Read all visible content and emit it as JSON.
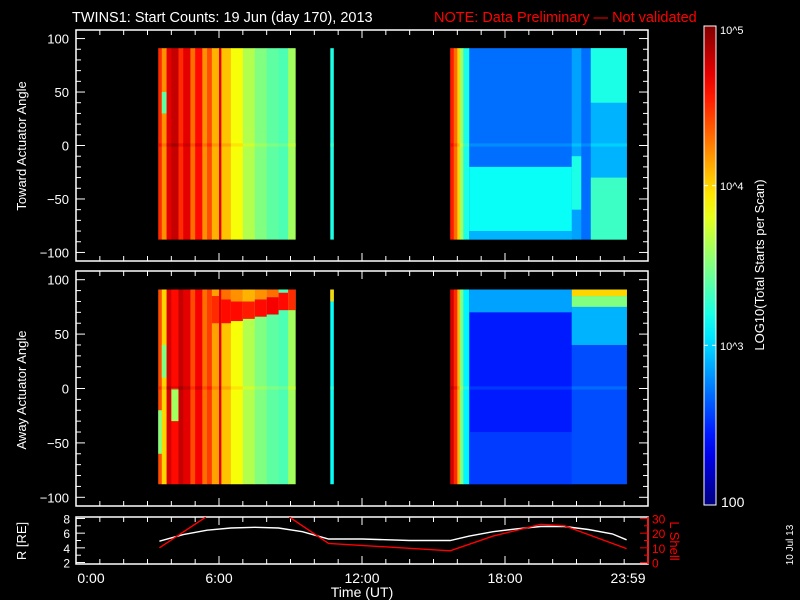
{
  "header": {
    "title": "TWINS1: Start Counts: 19 Jun (day 170), 2013",
    "note": "NOTE: Data Preliminary — Not validated"
  },
  "side_date": "10 Jul 13",
  "colors": {
    "background": "#000000",
    "axes": "#ffffff",
    "note": "#ff0000",
    "lshell": "#ff0000",
    "r": "#ffffff"
  },
  "colorbar": {
    "label": "LOG10(Total Starts per Scan)",
    "range_log10": [
      2,
      5
    ],
    "colormap": "jet",
    "ticks": [
      {
        "value": 5,
        "label": "10^5"
      },
      {
        "value": 4,
        "label": "10^4"
      },
      {
        "value": 3,
        "label": "10^3"
      },
      {
        "value": 2,
        "label": "100"
      }
    ]
  },
  "xaxis": {
    "label": "Time (UT)",
    "range_hours": [
      0,
      24
    ],
    "ticks": [
      {
        "value": 0,
        "label": "0:00"
      },
      {
        "value": 6,
        "label": "6:00"
      },
      {
        "value": 12,
        "label": "12:00"
      },
      {
        "value": 18,
        "label": "18:00"
      },
      {
        "value": 24,
        "label": "23:59"
      }
    ]
  },
  "chart_data": [
    {
      "type": "heatmap",
      "panel": "toward",
      "ylabel": "Toward Actuator Angle",
      "ylim": [
        -108,
        108
      ],
      "yticks": [
        "-100",
        "-50",
        "0",
        "50",
        "100"
      ],
      "angle_range": [
        -88,
        91
      ],
      "value_units": "log10 counts",
      "columns": [
        {
          "t": [
            3.45,
            3.6
          ],
          "v": 4.5
        },
        {
          "t": [
            3.6,
            3.8
          ],
          "v": 4.2,
          "bands": [
            {
              "a": [
                30,
                50
              ],
              "v": 3.4
            }
          ]
        },
        {
          "t": [
            3.8,
            4.0
          ],
          "v": 4.7
        },
        {
          "t": [
            4.0,
            4.3
          ],
          "v": 4.8
        },
        {
          "t": [
            4.3,
            4.5
          ],
          "v": 4.5
        },
        {
          "t": [
            4.5,
            4.8
          ],
          "v": 4.7
        },
        {
          "t": [
            4.8,
            5.0
          ],
          "v": 4.3
        },
        {
          "t": [
            5.0,
            5.3
          ],
          "v": 4.6
        },
        {
          "t": [
            5.3,
            5.5
          ],
          "v": 4.2
        },
        {
          "t": [
            5.5,
            5.7
          ],
          "v": 4.4
        },
        {
          "t": [
            5.7,
            6.0
          ],
          "v": 4.1
        },
        {
          "t": [
            6.0,
            6.1
          ],
          "v": 4.7
        },
        {
          "t": [
            6.1,
            6.5
          ],
          "v": 4.05
        },
        {
          "t": [
            6.5,
            7.0
          ],
          "v": 3.85
        },
        {
          "t": [
            7.0,
            7.5
          ],
          "v": 3.65
        },
        {
          "t": [
            7.5,
            8.0
          ],
          "v": 3.5
        },
        {
          "t": [
            8.0,
            8.5
          ],
          "v": 3.4
        },
        {
          "t": [
            8.5,
            8.9
          ],
          "v": 3.35
        },
        {
          "t": [
            8.9,
            9.2
          ],
          "v": 3.6
        },
        {
          "t": [
            10.67,
            10.8
          ],
          "v": 3.2
        },
        {
          "t": [
            15.7,
            15.85
          ],
          "v": 4.55
        },
        {
          "t": [
            15.85,
            16.0
          ],
          "v": 4.3
        },
        {
          "t": [
            16.0,
            16.1
          ],
          "v": 4.0
        },
        {
          "t": [
            16.1,
            16.25
          ],
          "v": 3.6
        },
        {
          "t": [
            16.25,
            16.5
          ],
          "v": 3.2
        },
        {
          "t": [
            16.5,
            20.8
          ],
          "v": 2.7,
          "bands": [
            {
              "a": [
                -80,
                -20
              ],
              "v": 3.15
            },
            {
              "a": [
                -88,
                -80
              ],
              "v": 2.9
            }
          ]
        },
        {
          "t": [
            20.8,
            21.2
          ],
          "v": 2.85,
          "bands": [
            {
              "a": [
                -60,
                -10
              ],
              "v": 3.2
            }
          ]
        },
        {
          "t": [
            21.2,
            21.6
          ],
          "v": 2.7
        },
        {
          "t": [
            21.6,
            23.1
          ],
          "v": 2.9,
          "bands": [
            {
              "a": [
                40,
                91
              ],
              "v": 3.2
            },
            {
              "a": [
                -88,
                -30
              ],
              "v": 3.3
            }
          ]
        }
      ]
    },
    {
      "type": "heatmap",
      "panel": "away",
      "ylabel": "Away Actuator Angle",
      "ylim": [
        -108,
        108
      ],
      "yticks": [
        "-100",
        "-50",
        "0",
        "50",
        "100"
      ],
      "angle_range": [
        -88,
        91
      ],
      "value_units": "log10 counts",
      "columns": [
        {
          "t": [
            3.45,
            3.6
          ],
          "v": 4.4,
          "bands": [
            {
              "a": [
                -60,
                -20
              ],
              "v": 3.5
            }
          ]
        },
        {
          "t": [
            3.6,
            3.8
          ],
          "v": 4.0,
          "bands": [
            {
              "a": [
                10,
                40
              ],
              "v": 3.5
            }
          ]
        },
        {
          "t": [
            3.8,
            4.0
          ],
          "v": 4.75
        },
        {
          "t": [
            4.0,
            4.3
          ],
          "v": 4.6,
          "bands": [
            {
              "a": [
                -30,
                0
              ],
              "v": 3.6
            }
          ]
        },
        {
          "t": [
            4.3,
            4.5
          ],
          "v": 4.8
        },
        {
          "t": [
            4.5,
            4.8
          ],
          "v": 4.7
        },
        {
          "t": [
            4.8,
            5.0
          ],
          "v": 4.4
        },
        {
          "t": [
            5.0,
            5.3
          ],
          "v": 4.65
        },
        {
          "t": [
            5.3,
            5.5
          ],
          "v": 4.3
        },
        {
          "t": [
            5.5,
            5.7
          ],
          "v": 4.45
        },
        {
          "t": [
            5.7,
            6.0
          ],
          "v": 4.15,
          "bands": [
            {
              "a": [
                60,
                85
              ],
              "v": 4.5
            }
          ]
        },
        {
          "t": [
            6.0,
            6.1
          ],
          "v": 4.7
        },
        {
          "t": [
            6.1,
            6.5
          ],
          "v": 4.05,
          "bands": [
            {
              "a": [
                60,
                82
              ],
              "v": 4.6
            },
            {
              "a": [
                82,
                91
              ],
              "v": 4.3
            }
          ]
        },
        {
          "t": [
            6.5,
            7.0
          ],
          "v": 3.85,
          "bands": [
            {
              "a": [
                62,
                80
              ],
              "v": 4.6
            },
            {
              "a": [
                80,
                91
              ],
              "v": 4.2
            }
          ]
        },
        {
          "t": [
            7.0,
            7.5
          ],
          "v": 3.65,
          "bands": [
            {
              "a": [
                64,
                80
              ],
              "v": 4.55
            },
            {
              "a": [
                80,
                91
              ],
              "v": 4.1
            }
          ]
        },
        {
          "t": [
            7.5,
            8.0
          ],
          "v": 3.5,
          "bands": [
            {
              "a": [
                66,
                82
              ],
              "v": 4.6
            },
            {
              "a": [
                82,
                91
              ],
              "v": 4.2
            }
          ]
        },
        {
          "t": [
            8.0,
            8.5
          ],
          "v": 3.4,
          "bands": [
            {
              "a": [
                68,
                84
              ],
              "v": 4.65
            },
            {
              "a": [
                84,
                91
              ],
              "v": 4.3
            }
          ]
        },
        {
          "t": [
            8.5,
            8.9
          ],
          "v": 3.35,
          "bands": [
            {
              "a": [
                72,
                88
              ],
              "v": 4.6
            }
          ]
        },
        {
          "t": [
            8.9,
            9.2
          ],
          "v": 3.6,
          "bands": [
            {
              "a": [
                72,
                91
              ],
              "v": 4.5
            }
          ]
        },
        {
          "t": [
            10.67,
            10.8
          ],
          "v": 3.15,
          "bands": [
            {
              "a": [
                80,
                91
              ],
              "v": 4.0
            }
          ]
        },
        {
          "t": [
            15.7,
            15.85
          ],
          "v": 4.75
        },
        {
          "t": [
            15.85,
            16.0
          ],
          "v": 4.5
        },
        {
          "t": [
            16.0,
            16.1
          ],
          "v": 4.1
        },
        {
          "t": [
            16.1,
            16.25
          ],
          "v": 3.5
        },
        {
          "t": [
            16.25,
            16.5
          ],
          "v": 3.1
        },
        {
          "t": [
            16.5,
            20.8
          ],
          "v": 2.45,
          "bands": [
            {
              "a": [
                70,
                91
              ],
              "v": 2.85
            },
            {
              "a": [
                -88,
                -40
              ],
              "v": 2.55
            }
          ]
        },
        {
          "t": [
            20.8,
            23.1
          ],
          "v": 2.6,
          "bands": [
            {
              "a": [
                40,
                75
              ],
              "v": 2.9
            },
            {
              "a": [
                75,
                85
              ],
              "v": 3.5
            },
            {
              "a": [
                85,
                91
              ],
              "v": 4.0
            }
          ]
        }
      ]
    },
    {
      "type": "line",
      "panel": "orbit",
      "ylabel": "R [RE]",
      "ylabel_right": "L Shell",
      "ylim": [
        1.8,
        8.2
      ],
      "yticks": [
        "2",
        "4",
        "6",
        "8"
      ],
      "ylim_right": [
        -1,
        31
      ],
      "yticks_right": [
        "0",
        "10",
        "20",
        "30"
      ],
      "series": [
        {
          "name": "R",
          "axis": "left",
          "color": "#ffffff",
          "segments": [
            [
              [
                3.5,
                4.9
              ],
              [
                4.5,
                5.8
              ],
              [
                5.5,
                6.4
              ],
              [
                6.5,
                6.7
              ],
              [
                7.5,
                6.8
              ],
              [
                8.5,
                6.7
              ],
              [
                9.5,
                6.2
              ],
              [
                10.6,
                5.2
              ],
              [
                12,
                5.2
              ],
              [
                14,
                5.0
              ],
              [
                15.7,
                5.0
              ],
              [
                16.5,
                5.6
              ],
              [
                17.5,
                6.2
              ],
              [
                18.5,
                6.6
              ],
              [
                19.5,
                6.9
              ],
              [
                20.5,
                6.9
              ],
              [
                21.5,
                6.5
              ],
              [
                22.5,
                5.9
              ],
              [
                23.1,
                5.1
              ]
            ]
          ]
        },
        {
          "name": "L Shell",
          "axis": "right",
          "color": "#ff0000",
          "segments": [
            [
              [
                3.5,
                10
              ],
              [
                5.45,
                31
              ]
            ],
            [
              [
                8.95,
                31
              ],
              [
                10.6,
                13
              ],
              [
                15.7,
                8
              ],
              [
                17.5,
                18
              ],
              [
                19.5,
                26
              ],
              [
                20.5,
                25
              ],
              [
                23.1,
                9.5
              ]
            ]
          ]
        }
      ]
    }
  ]
}
